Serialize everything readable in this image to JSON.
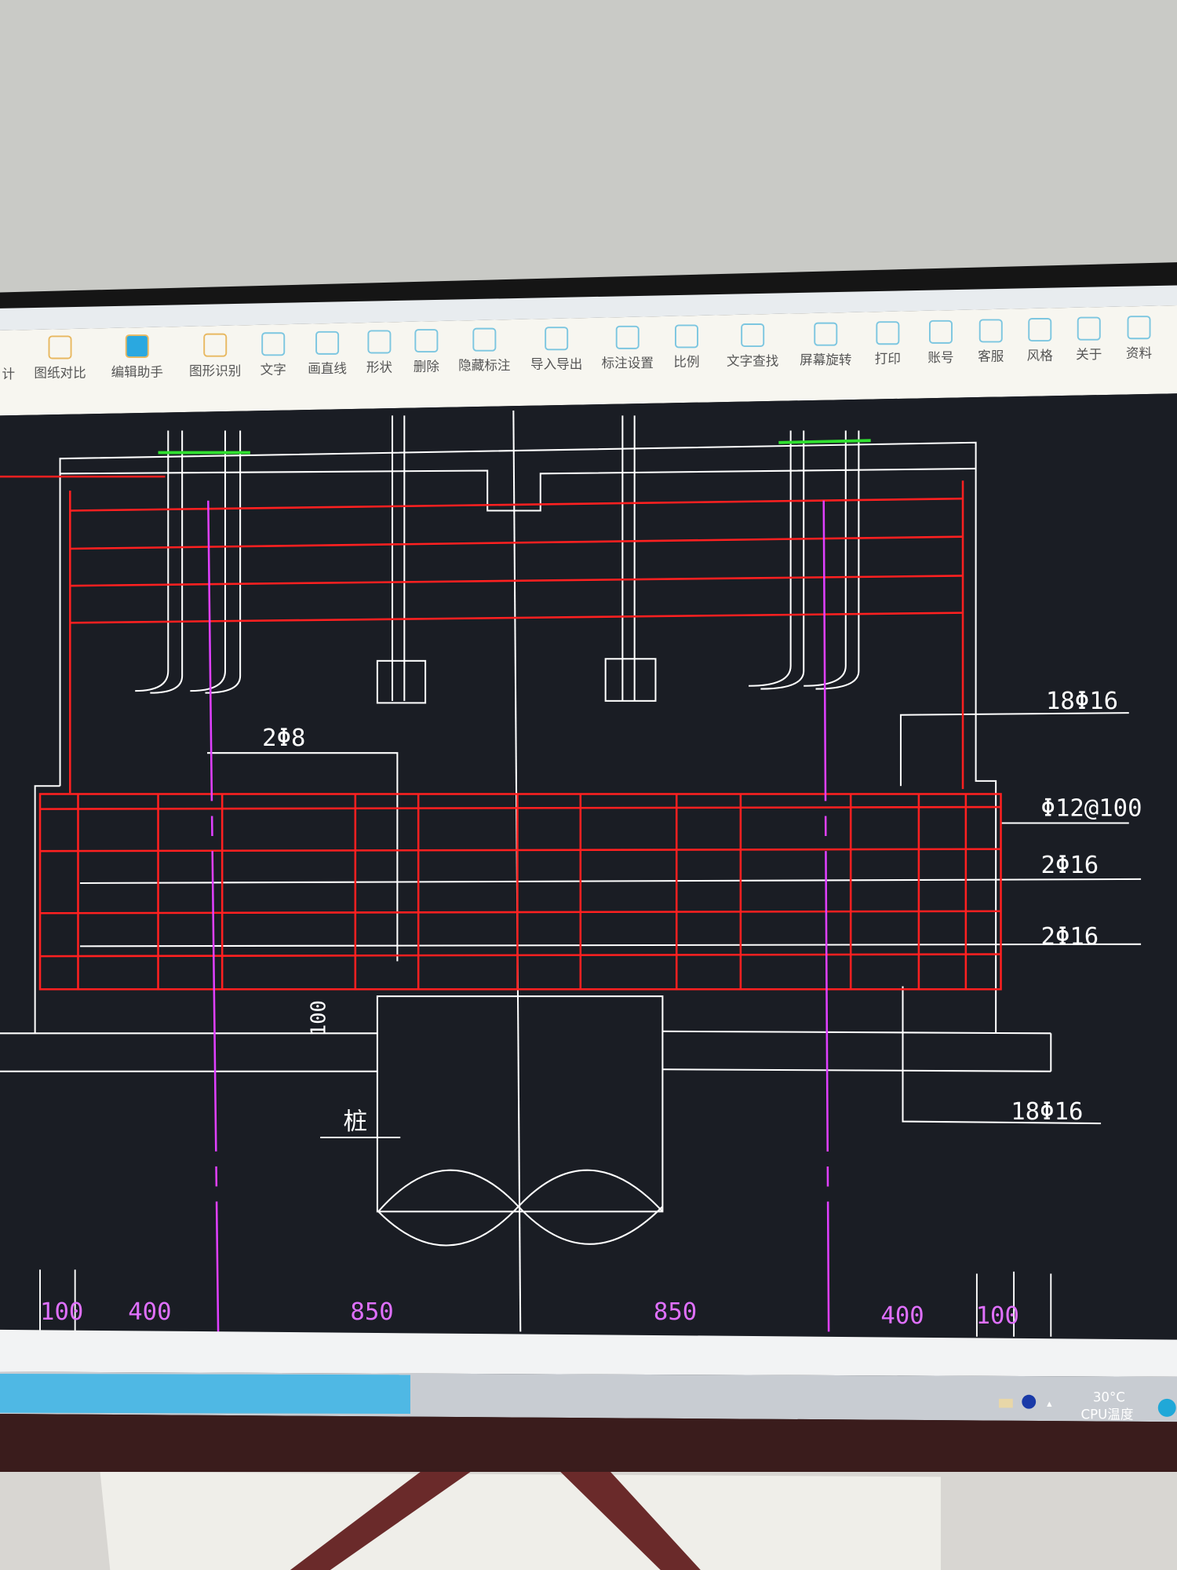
{
  "toolbar": {
    "items": [
      {
        "label": "计",
        "icon": "partial-icon"
      },
      {
        "label": "图纸对比",
        "icon": "compare-icon"
      },
      {
        "label": "编辑助手",
        "icon": "edit-assistant-icon"
      },
      {
        "label": "图形识别",
        "icon": "shape-recognition-icon"
      },
      {
        "label": "文字",
        "icon": "text-icon"
      },
      {
        "label": "画直线",
        "icon": "line-icon"
      },
      {
        "label": "形状",
        "icon": "shape-icon"
      },
      {
        "label": "删除",
        "icon": "eraser-icon"
      },
      {
        "label": "隐藏标注",
        "icon": "hide-icon"
      },
      {
        "label": "导入导出",
        "icon": "import-export-icon"
      },
      {
        "label": "标注设置",
        "icon": "annotation-settings-icon"
      },
      {
        "label": "比例",
        "icon": "scale-icon"
      },
      {
        "label": "文字查找",
        "icon": "text-search-icon"
      },
      {
        "label": "屏幕旋转",
        "icon": "rotate-screen-icon"
      },
      {
        "label": "打印",
        "icon": "print-icon"
      },
      {
        "label": "账号",
        "icon": "account-icon"
      },
      {
        "label": "客服",
        "icon": "headset-icon"
      },
      {
        "label": "风格",
        "icon": "style-icon"
      },
      {
        "label": "关于",
        "icon": "info-icon"
      },
      {
        "label": "资料",
        "icon": "documents-icon"
      }
    ]
  },
  "drawing": {
    "labels": {
      "top_right_rebar": "18Φ16",
      "stirrup": "Φ12@100",
      "side_rebar_1": "2Φ16",
      "side_rebar_2": "2Φ16",
      "bottom_right_rebar": "18Φ16",
      "top_left_rebar": "2Φ8",
      "cover": "100",
      "pile": "桩"
    },
    "dimensions": [
      "100",
      "400",
      "850",
      "850",
      "400",
      "100"
    ]
  },
  "taskbar": {
    "temperature": "30°C",
    "temperature_label": "CPU温度"
  },
  "colors": {
    "canvas": "#1a1d24",
    "rebar": "#ff2020",
    "outline": "#ffffff",
    "axis": "#e040ff",
    "plate": "#30e030",
    "toolbar_icon": "#3cb4d8"
  }
}
